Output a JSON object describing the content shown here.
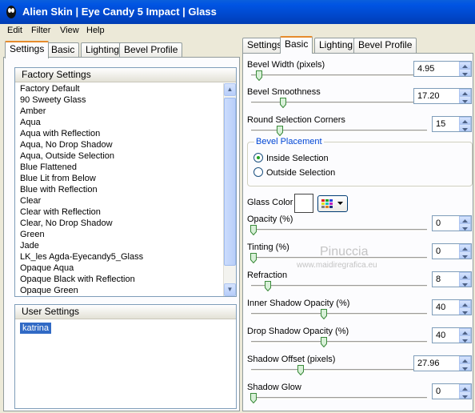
{
  "window": {
    "title": "Alien Skin | Eye Candy 5 Impact | Glass"
  },
  "menu": [
    "Edit",
    "Filter",
    "View",
    "Help"
  ],
  "left_tabs": [
    "Settings",
    "Basic",
    "Lighting",
    "Bevel Profile"
  ],
  "right_tabs": [
    "Settings",
    "Basic",
    "Lighting",
    "Bevel Profile"
  ],
  "factory": {
    "header": "Factory Settings",
    "items": [
      "Factory Default",
      "90 Sweety Glass",
      "Amber",
      "Aqua",
      "Aqua with Reflection",
      "Aqua, No Drop Shadow",
      "Aqua, Outside Selection",
      "Blue Flattened",
      "Blue Lit from Below",
      "Blue with Reflection",
      "Clear",
      "Clear with Reflection",
      "Clear, No Drop Shadow",
      "Green",
      "Jade",
      "LK_les Agda-Eyecandy5_Glass",
      "Opaque Aqua",
      "Opaque Black with Reflection",
      "Opaque Green"
    ]
  },
  "user": {
    "header": "User Settings",
    "selected": "katrina"
  },
  "basic": {
    "bevel_width": {
      "label": "Bevel Width (pixels)",
      "value": "4.95",
      "level": 0.03
    },
    "bevel_smoothness": {
      "label": "Bevel Smoothness",
      "value": "17.20",
      "level": 0.17
    },
    "round_corners": {
      "label": "Round Selection Corners",
      "value": "15",
      "level": 0.15
    },
    "placement": {
      "legend": "Bevel Placement",
      "inside": "Inside Selection",
      "outside": "Outside Selection",
      "selected": "inside"
    },
    "glass_color": {
      "label": "Glass Color",
      "color": "#ffffff"
    },
    "opacity": {
      "label": "Opacity (%)",
      "value": "0",
      "level": 0
    },
    "tinting": {
      "label": "Tinting (%)",
      "value": "0",
      "level": 0
    },
    "refraction": {
      "label": "Refraction",
      "value": "8",
      "level": 0.08
    },
    "inner_shadow": {
      "label": "Inner Shadow Opacity (%)",
      "value": "40",
      "level": 0.4
    },
    "drop_shadow": {
      "label": "Drop Shadow Opacity (%)",
      "value": "40",
      "level": 0.4
    },
    "shadow_offset": {
      "label": "Shadow Offset (pixels)",
      "value": "27.96",
      "level": 0.27
    },
    "shadow_glow": {
      "label": "Shadow Glow",
      "value": "0",
      "level": 0
    }
  },
  "watermark": {
    "name": "Pinuccia",
    "url": "www.maidiregrafica.eu"
  }
}
